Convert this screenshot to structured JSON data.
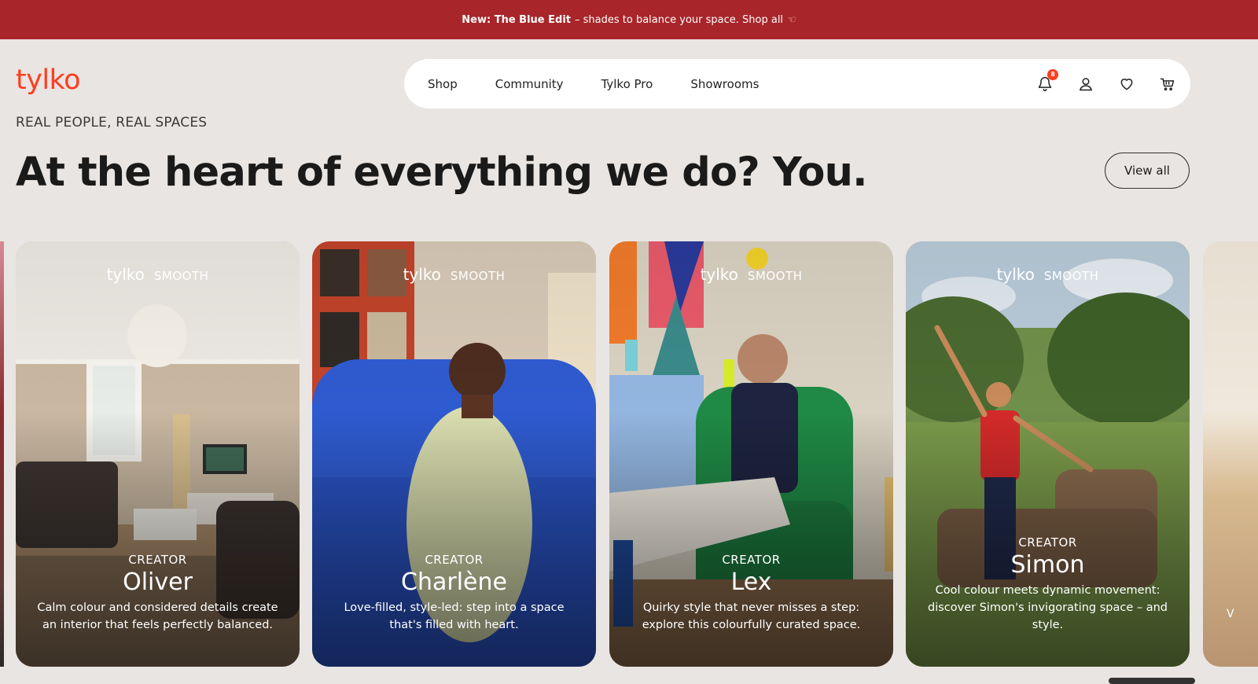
{
  "promo": {
    "bold": "New: The Blue Edit",
    "text": "– shades to balance your space. Shop all",
    "icon": "pointing-hand-icon"
  },
  "brand": {
    "logo": "tylko",
    "logo_color": "#ff3c1f"
  },
  "nav": {
    "items": [
      {
        "label": "Shop"
      },
      {
        "label": "Community"
      },
      {
        "label": "Tylko Pro"
      },
      {
        "label": "Showrooms"
      }
    ],
    "icons": {
      "notifications": "bell-icon",
      "notification_count": "8",
      "account": "user-icon",
      "wishlist": "heart-icon",
      "cart": "cart-icon"
    }
  },
  "section": {
    "eyebrow": "REAL PEOPLE, REAL SPACES",
    "headline": "At the heart of everything we do? You.",
    "view_all": "View all"
  },
  "cards": [
    {
      "brand": "tylko",
      "line": "SMOOTH",
      "role": "CREATOR",
      "name": "Oliver",
      "desc": "Calm colour and considered details create an interior that feels perfectly balanced."
    },
    {
      "brand": "tylko",
      "line": "SMOOTH",
      "role": "CREATOR",
      "name": "Charlène",
      "desc": "Love-filled, style-led: step into a space that's filled with heart."
    },
    {
      "brand": "tylko",
      "line": "SMOOTH",
      "role": "CREATOR",
      "name": "Lex",
      "desc": "Quirky style that never misses a step: explore this colourfully curated space."
    },
    {
      "brand": "tylko",
      "line": "SMOOTH",
      "role": "CREATOR",
      "name": "Simon",
      "desc": "Cool colour meets dynamic movement: discover Simon's invigorating space – and style."
    }
  ],
  "partial_card": {
    "initial": "V"
  },
  "colors": {
    "promo_bg": "#a8252a",
    "page_bg": "#e9e5e2",
    "accent": "#ff3c1f"
  }
}
